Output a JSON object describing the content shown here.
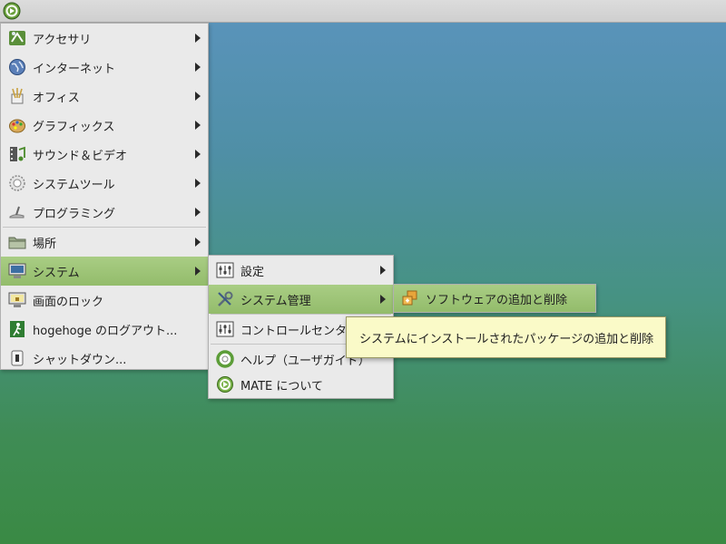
{
  "panel": {
    "menu_icon": "mate-logo-icon"
  },
  "main_menu": {
    "items": [
      {
        "label": "アクセサリ",
        "icon": "accessories-icon"
      },
      {
        "label": "インターネット",
        "icon": "internet-globe-icon"
      },
      {
        "label": "オフィス",
        "icon": "office-icon"
      },
      {
        "label": "グラフィックス",
        "icon": "graphics-palette-icon"
      },
      {
        "label": "サウンド＆ビデオ",
        "icon": "sound-video-icon"
      },
      {
        "label": "システムツール",
        "icon": "system-tools-gear-icon"
      },
      {
        "label": "プログラミング",
        "icon": "programming-icon"
      },
      {
        "label": "場所",
        "icon": "folder-icon"
      },
      {
        "label": "システム",
        "icon": "computer-icon"
      },
      {
        "label": "画面のロック",
        "icon": "lock-screen-icon"
      },
      {
        "label": "hogehoge のログアウト...",
        "icon": "logout-icon"
      },
      {
        "label": "シャットダウン...",
        "icon": "shutdown-icon"
      }
    ]
  },
  "system_menu": {
    "items": [
      {
        "label": "設定",
        "icon": "preferences-icon"
      },
      {
        "label": "システム管理",
        "icon": "administration-tools-icon"
      },
      {
        "label": "コントロールセンター",
        "icon": "control-center-icon"
      },
      {
        "label": "ヘルプ（ユーザガイド）",
        "icon": "help-lifebuoy-icon"
      },
      {
        "label": "MATE について",
        "icon": "mate-about-icon"
      }
    ]
  },
  "admin_menu": {
    "items": [
      {
        "label": "ソフトウェアの追加と削除",
        "icon": "software-package-icon"
      }
    ]
  },
  "tooltip": {
    "text": "システムにインストールされたパッケージの追加と削除"
  },
  "colors": {
    "highlight": "#a3c97c",
    "tooltip_bg": "#fafac8",
    "desktop_top": "#5b94bd",
    "desktop_bottom": "#3a8a44"
  }
}
